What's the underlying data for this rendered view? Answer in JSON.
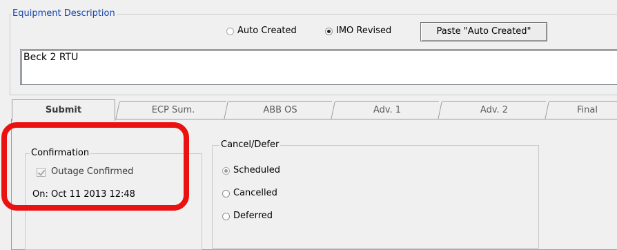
{
  "equipment": {
    "group_label": "Equipment Description",
    "options": [
      {
        "label": "Auto Created",
        "checked": false
      },
      {
        "label": "IMO Revised",
        "checked": true
      }
    ],
    "paste_button": "Paste \"Auto Created\"",
    "description_value": "Beck 2 RTU"
  },
  "tabs": [
    {
      "label": "Submit",
      "active": true
    },
    {
      "label": "ECP Sum.",
      "active": false
    },
    {
      "label": "ABB OS",
      "active": false
    },
    {
      "label": "Adv. 1",
      "active": false
    },
    {
      "label": "Adv. 2",
      "active": false
    },
    {
      "label": "Final",
      "active": false
    }
  ],
  "confirmation": {
    "group_label": "Confirmation",
    "checkbox_label": "Outage Confirmed",
    "checked": true,
    "on_text": "On: Oct 11 2013 12:48"
  },
  "cancel_defer": {
    "group_label": "Cancel/Defer",
    "options": [
      {
        "label": "Scheduled",
        "checked": true
      },
      {
        "label": "Cancelled",
        "checked": false
      },
      {
        "label": "Deferred",
        "checked": false
      }
    ]
  },
  "colors": {
    "group_legend_blue": "#1446b4",
    "highlight_red": "#ea1111"
  }
}
